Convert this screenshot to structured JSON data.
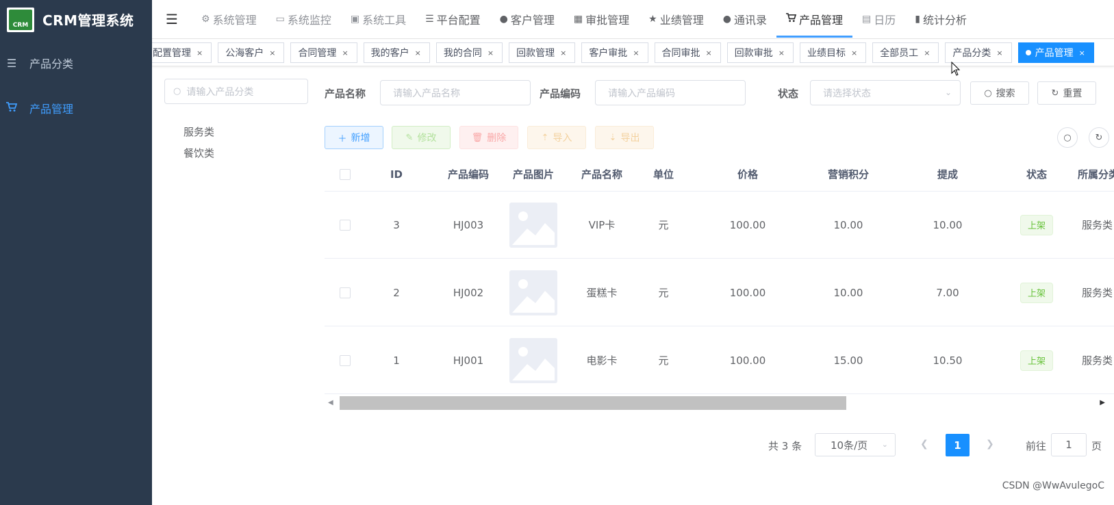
{
  "app": {
    "logo_text": "CRM",
    "title": "CRM管理系统"
  },
  "sidebar": {
    "items": [
      {
        "label": "产品分类",
        "icon": "list-icon"
      },
      {
        "label": "产品管理",
        "icon": "cart-icon"
      }
    ]
  },
  "topnav": {
    "items": [
      {
        "label": "系统管理",
        "icon": "gear-icon"
      },
      {
        "label": "系统监控",
        "icon": "monitor-icon"
      },
      {
        "label": "系统工具",
        "icon": "toolbox-icon"
      },
      {
        "label": "平台配置",
        "icon": "list-icon"
      },
      {
        "label": "客户管理",
        "icon": "user-icon"
      },
      {
        "label": "审批管理",
        "icon": "grid-icon"
      },
      {
        "label": "业绩管理",
        "icon": "star-icon"
      },
      {
        "label": "通讯录",
        "icon": "user-icon"
      },
      {
        "label": "产品管理",
        "icon": "cart-icon"
      },
      {
        "label": "日历",
        "icon": "calendar-icon"
      },
      {
        "label": "统计分析",
        "icon": "bar-chart-icon"
      }
    ]
  },
  "tags": [
    {
      "label": "配置管理"
    },
    {
      "label": "公海客户"
    },
    {
      "label": "合同管理"
    },
    {
      "label": "我的客户"
    },
    {
      "label": "我的合同"
    },
    {
      "label": "回款管理"
    },
    {
      "label": "客户审批"
    },
    {
      "label": "合同审批"
    },
    {
      "label": "回款审批"
    },
    {
      "label": "业绩目标"
    },
    {
      "label": "全部员工"
    },
    {
      "label": "产品分类"
    },
    {
      "label": "产品管理"
    }
  ],
  "tag_close": "×",
  "tree": {
    "search_placeholder": "请输入产品分类",
    "nodes": [
      "服务类",
      "餐饮类"
    ]
  },
  "form": {
    "name_label": "产品名称",
    "name_placeholder": "请输入产品名称",
    "code_label": "产品编码",
    "code_placeholder": "请输入产品编码",
    "status_label": "状态",
    "status_placeholder": "请选择状态",
    "search_btn": "搜索",
    "reset_btn": "重置"
  },
  "toolbar": {
    "add": "新增",
    "edit": "修改",
    "delete": "删除",
    "import": "导入",
    "export": "导出"
  },
  "table": {
    "columns": [
      "ID",
      "产品编码",
      "产品图片",
      "产品名称",
      "单位",
      "价格",
      "营销积分",
      "提成",
      "状态",
      "所属分类"
    ],
    "rows": [
      {
        "id": "3",
        "code": "HJ003",
        "name": "VIP卡",
        "unit": "元",
        "price": "100.00",
        "points": "10.00",
        "commission": "10.00",
        "status": "上架",
        "category": "服务类"
      },
      {
        "id": "2",
        "code": "HJ002",
        "name": "蛋糕卡",
        "unit": "元",
        "price": "100.00",
        "points": "10.00",
        "commission": "7.00",
        "status": "上架",
        "category": "服务类"
      },
      {
        "id": "1",
        "code": "HJ001",
        "name": "电影卡",
        "unit": "元",
        "price": "100.00",
        "points": "15.00",
        "commission": "10.50",
        "status": "上架",
        "category": "服务类"
      }
    ]
  },
  "pagination": {
    "total": "共 3 条",
    "page_size": "10条/页",
    "current": "1",
    "goto_label": "前往",
    "goto_value": "1",
    "goto_unit": "页"
  },
  "watermark": "CSDN @WwAvulegoC",
  "colors": {
    "primary": "#1890ff",
    "sidebar_bg": "#2b3a4d",
    "price": "#f56c6c",
    "success": "#67c23a"
  }
}
